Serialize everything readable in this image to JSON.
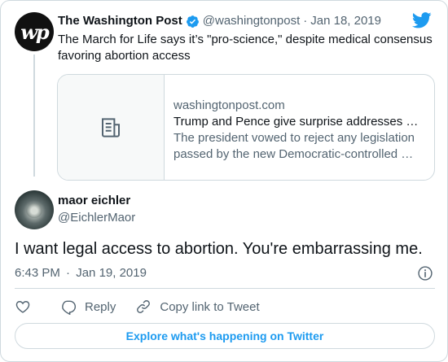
{
  "colors": {
    "accent": "#1d9bf0",
    "text": "#0f1419",
    "secondary": "#536471",
    "border": "#cfd9de"
  },
  "parent_tweet": {
    "avatar_icon": "washington-post-logo",
    "name": "The Washington Post",
    "verified_icon": "verified-badge-icon",
    "handle": "@washingtonpost",
    "separator": "·",
    "date": "Jan 18, 2019",
    "text": "The March for Life says it’s \"pro-science,\" despite medical consensus favoring abortion access",
    "card": {
      "thumb_icon": "article-icon",
      "domain": "washingtonpost.com",
      "title": "Trump and Pence give surprise addresses …",
      "desc_line1": "The president vowed to reject any legislation",
      "desc_line2": "passed by the new Democratic-controlled …"
    }
  },
  "brand_icon": "twitter-bird-icon",
  "main_tweet": {
    "name": "maor eichler",
    "handle": "@EichlerMaor",
    "text": "I want legal access to abortion. You're embarrassing me.",
    "time": "6:43 PM",
    "separator": "·",
    "date": "Jan 19, 2019",
    "info_icon": "info-icon"
  },
  "actions": {
    "like_icon": "heart-icon",
    "reply_icon": "reply-icon",
    "reply_label": "Reply",
    "copy_icon": "link-icon",
    "copy_label": "Copy link to Tweet"
  },
  "explore_label": "Explore what's happening on Twitter"
}
